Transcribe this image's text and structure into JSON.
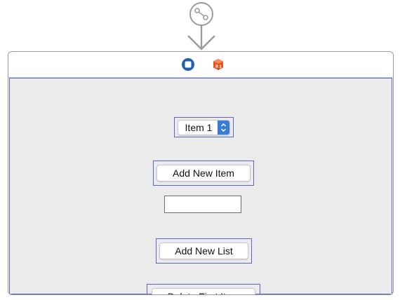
{
  "popup": {
    "selected": "Item 1"
  },
  "buttons": {
    "add_item": "Add New Item",
    "add_list": "Add New List",
    "delete_first": "Delete First Item"
  },
  "text_field": {
    "value": ""
  },
  "icons": {
    "entry_point": "storyboard-entry-arrow-icon",
    "view_controller": "view-controller-icon",
    "first_responder": "first-responder-cube-icon"
  },
  "colors": {
    "selection_outline": "#5a66c8",
    "view_background": "#ebebeb",
    "popup_accent": "#3a7bd5",
    "cube": "#e8521e"
  }
}
